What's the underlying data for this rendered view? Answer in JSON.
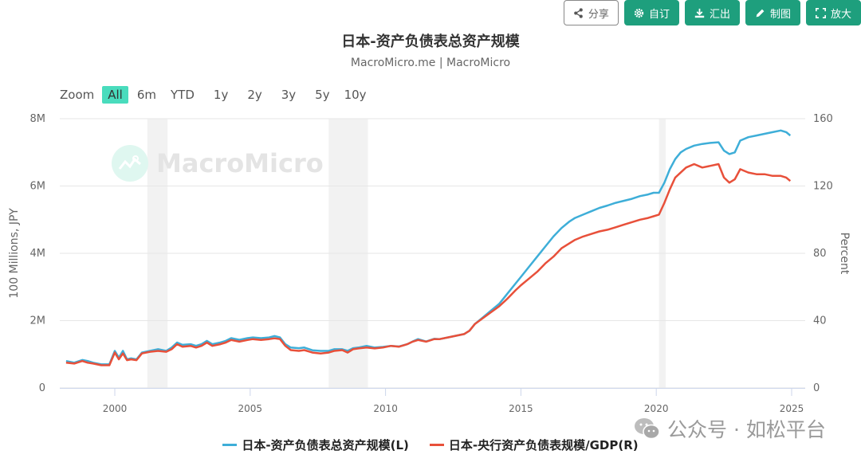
{
  "toolbar": {
    "buttons": [
      {
        "label": "分享",
        "icon": "share-icon"
      },
      {
        "label": "自订",
        "icon": "gear-icon"
      },
      {
        "label": "汇出",
        "icon": "download-icon"
      },
      {
        "label": "制图",
        "icon": "pencil-icon"
      },
      {
        "label": "放大",
        "icon": "expand-icon"
      }
    ]
  },
  "zoom": {
    "label": "Zoom",
    "options": [
      "All",
      "6m",
      "YTD",
      "1y",
      "2y",
      "3y",
      "5y",
      "10y"
    ],
    "active": "All"
  },
  "watermark": {
    "brand": "MacroMicro"
  },
  "wechat_watermark": "公众号 · 如松平台",
  "colors": {
    "series_left": "#3eaed8",
    "series_right": "#e8503a",
    "brand": "#1e9f7d",
    "zoom_active": "#49dcbd",
    "shade": "#f2f2f2"
  },
  "chart_data": {
    "type": "line",
    "title": "日本-资产负债表总资产规模",
    "subtitle": "MacroMicro.me | MacroMicro",
    "xlabel": "",
    "ylabel_left": "100 Millions, JPY",
    "ylabel_right": "Percent",
    "xlim": [
      1998,
      2025.2
    ],
    "ylim_left": [
      0,
      8000000
    ],
    "ylim_right": [
      0,
      160
    ],
    "xticks": [
      2000,
      2005,
      2010,
      2015,
      2020,
      2025
    ],
    "yticks_left": [
      {
        "v": 0,
        "label": "0"
      },
      {
        "v": 2000000,
        "label": "2M"
      },
      {
        "v": 4000000,
        "label": "4M"
      },
      {
        "v": 6000000,
        "label": "6M"
      },
      {
        "v": 8000000,
        "label": "8M"
      }
    ],
    "yticks_right": [
      0,
      40,
      80,
      120,
      160
    ],
    "grid": true,
    "legend_position": "bottom",
    "shaded_periods": [
      [
        2001.2,
        2001.95
      ],
      [
        2007.9,
        2009.35
      ],
      [
        2020.1,
        2020.35
      ]
    ],
    "series": [
      {
        "name": "日本-资产负债表总资产规模(L)",
        "axis": "left",
        "x": [
          1998.2,
          1998.5,
          1998.8,
          1999.0,
          1999.2,
          1999.5,
          1999.8,
          2000.0,
          2000.15,
          2000.3,
          2000.45,
          2000.6,
          2000.8,
          2001.0,
          2001.3,
          2001.6,
          2001.9,
          2002.1,
          2002.3,
          2002.5,
          2002.8,
          2003.0,
          2003.2,
          2003.4,
          2003.6,
          2003.9,
          2004.1,
          2004.3,
          2004.6,
          2004.9,
          2005.1,
          2005.4,
          2005.7,
          2005.9,
          2006.1,
          2006.3,
          2006.5,
          2006.8,
          2007.0,
          2007.3,
          2007.6,
          2007.9,
          2008.1,
          2008.4,
          2008.6,
          2008.8,
          2009.0,
          2009.3,
          2009.6,
          2009.9,
          2010.2,
          2010.5,
          2010.8,
          2011.0,
          2011.2,
          2011.5,
          2011.8,
          2012.0,
          2012.3,
          2012.6,
          2012.9,
          2013.1,
          2013.3,
          2013.6,
          2013.9,
          2014.2,
          2014.5,
          2014.8,
          2015.0,
          2015.3,
          2015.6,
          2015.9,
          2016.2,
          2016.5,
          2016.8,
          2017.0,
          2017.3,
          2017.6,
          2017.9,
          2018.2,
          2018.5,
          2018.8,
          2019.1,
          2019.4,
          2019.7,
          2019.9,
          2020.1,
          2020.3,
          2020.5,
          2020.7,
          2020.9,
          2021.1,
          2021.4,
          2021.7,
          2022.0,
          2022.3,
          2022.5,
          2022.7,
          2022.9,
          2023.1,
          2023.4,
          2023.7,
          2024.0,
          2024.3,
          2024.6,
          2024.8,
          2024.95
        ],
        "values": [
          800000,
          750000,
          830000,
          800000,
          750000,
          700000,
          700000,
          1100000,
          900000,
          1100000,
          850000,
          880000,
          850000,
          1050000,
          1100000,
          1150000,
          1100000,
          1200000,
          1350000,
          1280000,
          1300000,
          1250000,
          1300000,
          1400000,
          1300000,
          1350000,
          1400000,
          1480000,
          1430000,
          1480000,
          1500000,
          1480000,
          1500000,
          1540000,
          1500000,
          1300000,
          1200000,
          1180000,
          1200000,
          1120000,
          1100000,
          1100000,
          1150000,
          1150000,
          1100000,
          1180000,
          1200000,
          1250000,
          1200000,
          1220000,
          1250000,
          1230000,
          1300000,
          1380000,
          1450000,
          1380000,
          1460000,
          1450000,
          1500000,
          1550000,
          1600000,
          1700000,
          1900000,
          2100000,
          2300000,
          2500000,
          2800000,
          3100000,
          3300000,
          3600000,
          3900000,
          4200000,
          4500000,
          4750000,
          4950000,
          5050000,
          5150000,
          5250000,
          5350000,
          5420000,
          5500000,
          5560000,
          5620000,
          5700000,
          5750000,
          5800000,
          5800000,
          6100000,
          6500000,
          6800000,
          7000000,
          7100000,
          7200000,
          7250000,
          7280000,
          7300000,
          7050000,
          6950000,
          7000000,
          7350000,
          7450000,
          7500000,
          7550000,
          7600000,
          7650000,
          7600000,
          7500000
        ]
      },
      {
        "name": "日本-央行资产负债表规模/GDP(R)",
        "axis": "right",
        "x": [
          1998.2,
          1998.5,
          1998.8,
          1999.0,
          1999.2,
          1999.5,
          1999.8,
          2000.0,
          2000.15,
          2000.3,
          2000.45,
          2000.6,
          2000.8,
          2001.0,
          2001.3,
          2001.6,
          2001.9,
          2002.1,
          2002.3,
          2002.5,
          2002.8,
          2003.0,
          2003.2,
          2003.4,
          2003.6,
          2003.9,
          2004.1,
          2004.3,
          2004.6,
          2004.9,
          2005.1,
          2005.4,
          2005.7,
          2005.9,
          2006.1,
          2006.3,
          2006.5,
          2006.8,
          2007.0,
          2007.3,
          2007.6,
          2007.9,
          2008.1,
          2008.4,
          2008.6,
          2008.8,
          2009.0,
          2009.3,
          2009.6,
          2009.9,
          2010.2,
          2010.5,
          2010.8,
          2011.0,
          2011.2,
          2011.5,
          2011.8,
          2012.0,
          2012.3,
          2012.6,
          2012.9,
          2013.1,
          2013.3,
          2013.6,
          2013.9,
          2014.2,
          2014.5,
          2014.8,
          2015.0,
          2015.3,
          2015.6,
          2015.9,
          2016.2,
          2016.5,
          2016.8,
          2017.0,
          2017.3,
          2017.6,
          2017.9,
          2018.2,
          2018.5,
          2018.8,
          2019.1,
          2019.4,
          2019.7,
          2019.9,
          2020.1,
          2020.3,
          2020.5,
          2020.7,
          2020.9,
          2021.1,
          2021.4,
          2021.7,
          2022.0,
          2022.3,
          2022.5,
          2022.7,
          2022.9,
          2023.1,
          2023.4,
          2023.7,
          2024.0,
          2024.3,
          2024.6,
          2024.8,
          2024.95
        ],
        "values": [
          15,
          14.5,
          16,
          15,
          14.5,
          13.5,
          13.5,
          21,
          17,
          20.5,
          16.5,
          17,
          16.5,
          20.5,
          21.5,
          22,
          21.5,
          23,
          26,
          24.5,
          25,
          24,
          25,
          27,
          25,
          26,
          27,
          28.5,
          27.5,
          28.5,
          29,
          28.5,
          29,
          29.5,
          29,
          25,
          22.5,
          22,
          22.5,
          21,
          20.5,
          21,
          22,
          22.5,
          21,
          23,
          23.5,
          24,
          23.5,
          24,
          25,
          24.5,
          26,
          27.5,
          28.5,
          27.5,
          29,
          29,
          30,
          31,
          32,
          34,
          38,
          41.5,
          45,
          48.5,
          53,
          58,
          61,
          65,
          69,
          74,
          78,
          83,
          86,
          88,
          90,
          91.5,
          93,
          94,
          95.5,
          97,
          98.5,
          100,
          101,
          102,
          103,
          110,
          118,
          125,
          128,
          131,
          133,
          131,
          132,
          133,
          125,
          122,
          124,
          130,
          128,
          127,
          127,
          126,
          126,
          125,
          123
        ]
      }
    ]
  }
}
